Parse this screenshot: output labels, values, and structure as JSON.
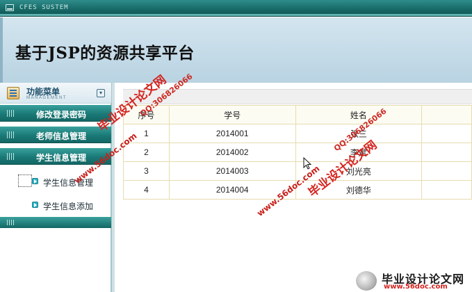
{
  "window": {
    "title": "CFES SUSTEM"
  },
  "banner": {
    "title": "基于JSP的资源共享平台"
  },
  "sidebar": {
    "header": {
      "title": "功能菜单",
      "subtitle": "MANAGEMENT",
      "collapse_icon": "double-chevron-down-icon"
    },
    "groups": [
      {
        "label": "修改登录密码"
      },
      {
        "label": "老师信息管理"
      },
      {
        "label": "学生信息管理"
      }
    ],
    "sub_items": [
      {
        "label": "学生信息管理",
        "active": true
      },
      {
        "label": "学生信息添加",
        "active": false
      }
    ]
  },
  "table": {
    "columns": [
      "序号",
      "学号",
      "姓名",
      ""
    ],
    "rows": [
      [
        "1",
        "2014001",
        "张三",
        ""
      ],
      [
        "2",
        "2014002",
        "李斌",
        ""
      ],
      [
        "3",
        "2014003",
        "刘光亮",
        ""
      ],
      [
        "4",
        "2014004",
        "刘德华",
        ""
      ]
    ]
  },
  "watermarks": {
    "brand": "毕业设计论文网",
    "site": "www.56doc.com",
    "qq": "QQ:306826066",
    "corner_brand": "毕业设计论文网",
    "corner_url": "www.56doc.com"
  },
  "colors": {
    "accent": "#1a7a77",
    "banner": "#c4dce8",
    "watermark": "#d4241f",
    "table_border": "#e6dcae"
  }
}
